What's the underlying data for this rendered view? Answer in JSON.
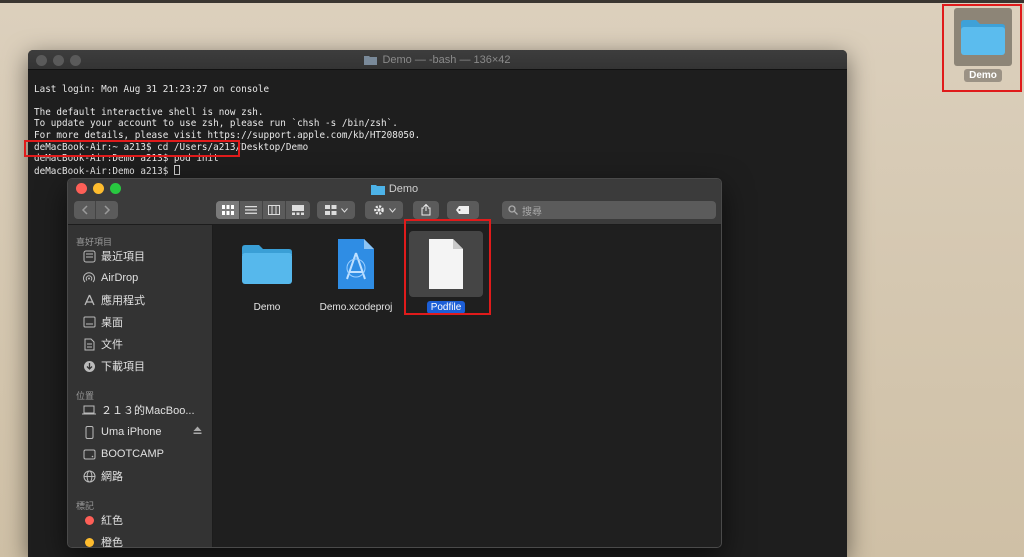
{
  "desktop": {
    "folder_label": "Demo"
  },
  "terminal": {
    "title": "Demo — -bash — 136×42",
    "lines": {
      "l1": "Last login: Mon Aug 31 21:23:27 on console",
      "l2": "",
      "l3": "The default interactive shell is now zsh.",
      "l4": "To update your account to use zsh, please run `chsh -s /bin/zsh`.",
      "l5": "For more details, please visit https://support.apple.com/kb/HT208050.",
      "l6": "deMacBook-Air:~ a213$ cd /Users/a213/Desktop/Demo",
      "l7": "deMacBook-Air:Demo a213$ pod init",
      "l8": "deMacBook-Air:Demo a213$ "
    }
  },
  "finder": {
    "title": "Demo",
    "search_placeholder": "搜尋",
    "sidebar": {
      "favorites_header": "喜好項目",
      "favorites": [
        "最近項目",
        "AirDrop",
        "應用程式",
        "桌面",
        "文件",
        "下載項目"
      ],
      "locations_header": "位置",
      "locations": [
        "２１３的MacBoo...",
        "Uma iPhone",
        "BOOTCAMP",
        "網路"
      ],
      "tags_header": "標記",
      "tags": [
        "紅色",
        "橙色"
      ]
    },
    "files": [
      {
        "name": "Demo"
      },
      {
        "name": "Demo.xcodeproj"
      },
      {
        "name": "Podfile"
      }
    ]
  },
  "colors": {
    "highlight": "#e01b1b",
    "selection": "#1c5ed6",
    "folder_blue": "#4db3e8",
    "tag_red": "#fe5f57",
    "tag_orange": "#febc2e"
  }
}
